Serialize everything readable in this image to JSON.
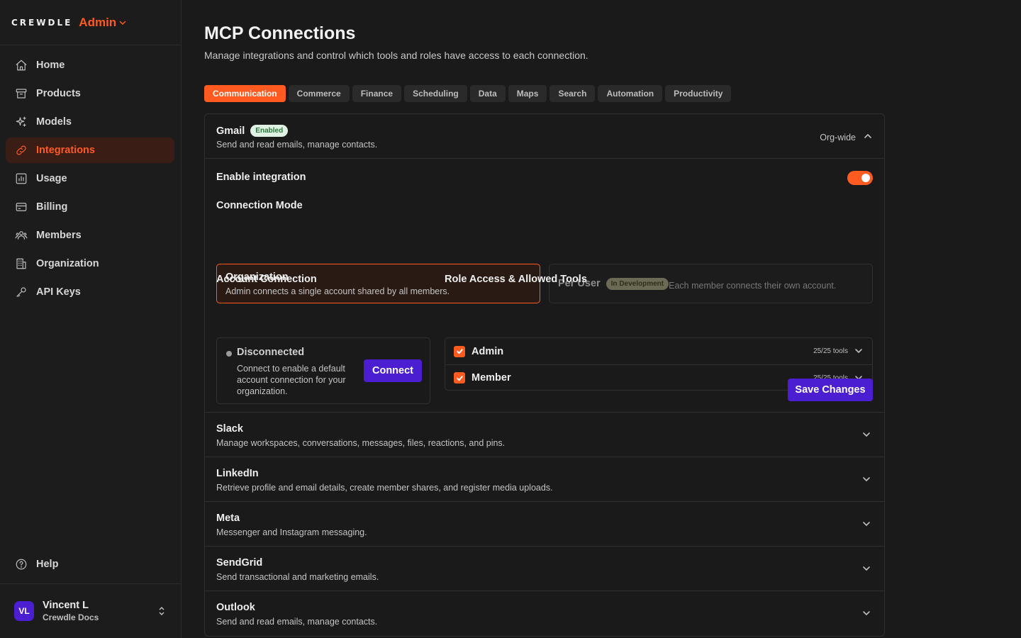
{
  "brand": {
    "logo": "CREWDLE",
    "admin_label": "Admin"
  },
  "nav": {
    "items": [
      {
        "label": "Home",
        "icon": "home-icon"
      },
      {
        "label": "Products",
        "icon": "box-icon"
      },
      {
        "label": "Models",
        "icon": "sparkle-icon"
      },
      {
        "label": "Integrations",
        "icon": "link-icon",
        "active": true
      },
      {
        "label": "Usage",
        "icon": "chart-icon"
      },
      {
        "label": "Billing",
        "icon": "card-icon"
      },
      {
        "label": "Members",
        "icon": "users-icon"
      },
      {
        "label": "Organization",
        "icon": "building-icon"
      },
      {
        "label": "API Keys",
        "icon": "key-icon"
      }
    ],
    "help": "Help"
  },
  "user": {
    "initials": "VL",
    "name": "Vincent L",
    "org": "Crewdle Docs"
  },
  "page": {
    "title": "MCP Connections",
    "subtitle": "Manage integrations and control which tools and roles have access to each connection."
  },
  "tabs": [
    "Communication",
    "Commerce",
    "Finance",
    "Scheduling",
    "Data",
    "Maps",
    "Search",
    "Automation",
    "Productivity"
  ],
  "gmail": {
    "name": "Gmail",
    "badge": "Enabled",
    "desc": "Send and read emails, manage contacts.",
    "scope": "Org-wide",
    "enable_label": "Enable integration",
    "mode_label": "Connection Mode",
    "org_title": "Organization",
    "org_desc": "Admin connects a single account shared by all members.",
    "user_title": "Per User",
    "user_badge": "In Development",
    "user_desc": "Each member connects their own account.",
    "account_label": "Account Connection",
    "account_status": "Disconnected",
    "account_desc": "Connect to enable a default account connection for your organization.",
    "connect_label": "Connect",
    "roles_label": "Role Access & Allowed Tools",
    "roles": [
      {
        "name": "Admin",
        "tools": "25/25 tools"
      },
      {
        "name": "Member",
        "tools": "25/25 tools"
      }
    ],
    "save_label": "Save Changes"
  },
  "integrations": [
    {
      "name": "Slack",
      "desc": "Manage workspaces, conversations, messages, files, reactions, and pins."
    },
    {
      "name": "LinkedIn",
      "desc": "Retrieve profile and email details, create member shares, and register media uploads."
    },
    {
      "name": "Meta",
      "desc": "Messenger and Instagram messaging."
    },
    {
      "name": "SendGrid",
      "desc": "Send transactional and marketing emails."
    },
    {
      "name": "Outlook",
      "desc": "Send and read emails, manage contacts."
    }
  ],
  "colors": {
    "accent": "#ff5a1f",
    "primary": "#4b1fd1",
    "background": "#1a1a1a"
  }
}
